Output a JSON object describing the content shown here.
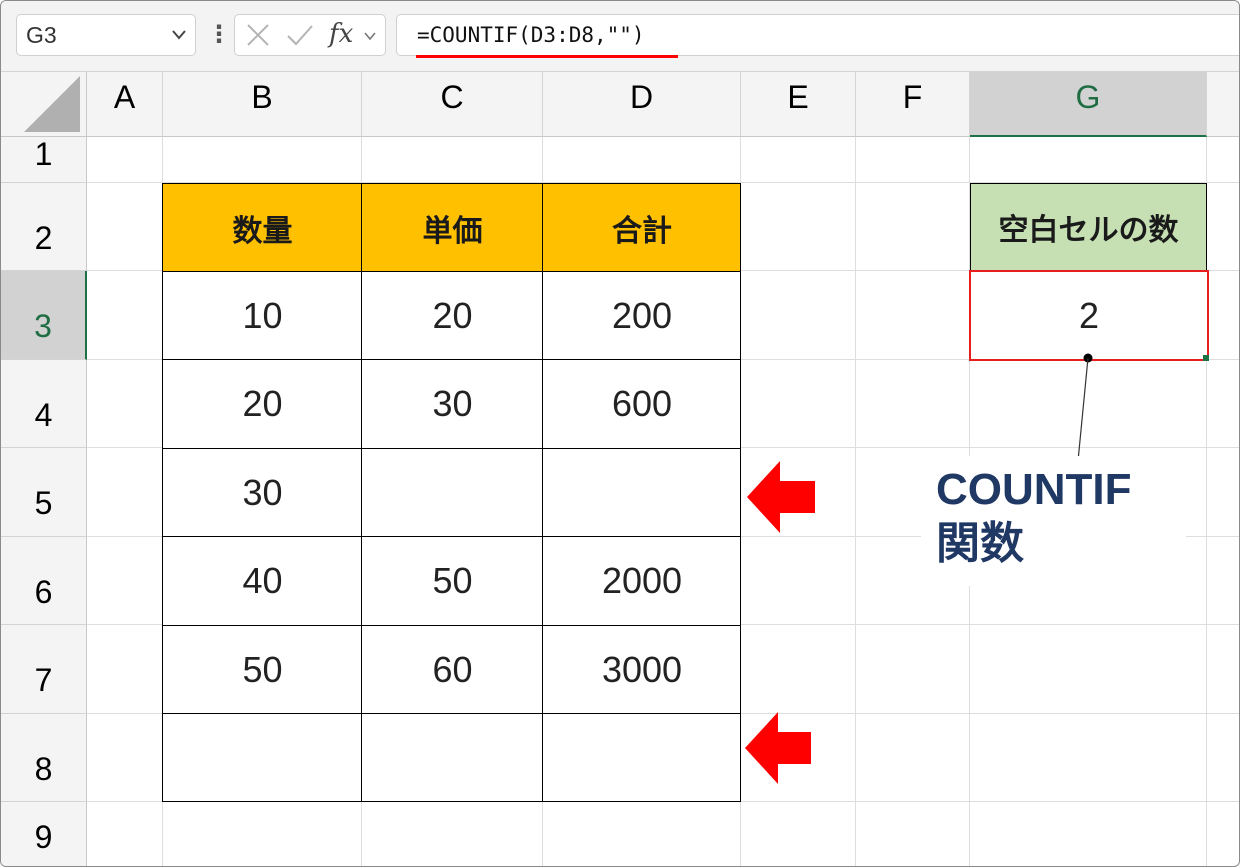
{
  "formula_bar": {
    "name_box": "G3",
    "cancel_icon": "x-icon",
    "enter_icon": "check-icon",
    "fx_label": "fx",
    "formula": "=COUNTIF(D3:D8,\"\")"
  },
  "columns": [
    "A",
    "B",
    "C",
    "D",
    "E",
    "F",
    "G"
  ],
  "rows": [
    "1",
    "2",
    "3",
    "4",
    "5",
    "6",
    "7",
    "8",
    "9"
  ],
  "selected_cell": {
    "column": "G",
    "row": "3"
  },
  "table": {
    "headers": [
      "数量",
      "単価",
      "合計"
    ],
    "rows": [
      [
        "10",
        "20",
        "200"
      ],
      [
        "20",
        "30",
        "600"
      ],
      [
        "30",
        "",
        ""
      ],
      [
        "40",
        "50",
        "2000"
      ],
      [
        "50",
        "60",
        "3000"
      ],
      [
        "",
        "",
        ""
      ]
    ]
  },
  "result": {
    "header": "空白セルの数",
    "value": "2"
  },
  "annotation": {
    "line1": "COUNTIF",
    "line2": "関数",
    "arrow_color": "#ff0000",
    "text_color": "#203864"
  },
  "colors": {
    "header_fill": "#ffc000",
    "result_header_fill": "#c6e0b4",
    "highlight_border": "#e61e1e",
    "selection_green": "#1e7145"
  }
}
